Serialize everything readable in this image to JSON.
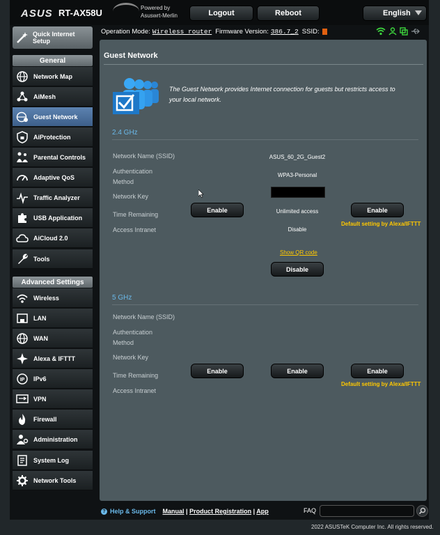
{
  "header": {
    "brand": "ASUS",
    "model": "RT-AX58U",
    "powered_by": "Powered by",
    "merlin": "Asuswrt-Merlin",
    "logout": "Logout",
    "reboot": "Reboot",
    "language": "English"
  },
  "status": {
    "op_mode_label": "Operation Mode:",
    "op_mode_value": "Wireless router",
    "fw_label": "Firmware Version:",
    "fw_value": "386.7_2",
    "ssid_label": "SSID:"
  },
  "sidebar": {
    "qis": "Quick Internet Setup",
    "general_heading": "General",
    "general_items": [
      "Network Map",
      "AiMesh",
      "Guest Network",
      "AiProtection",
      "Parental Controls",
      "Adaptive QoS",
      "Traffic Analyzer",
      "USB Application",
      "AiCloud 2.0",
      "Tools"
    ],
    "advanced_heading": "Advanced Settings",
    "advanced_items": [
      "Wireless",
      "LAN",
      "WAN",
      "Alexa & IFTTT",
      "IPv6",
      "VPN",
      "Firewall",
      "Administration",
      "System Log",
      "Network Tools"
    ]
  },
  "main": {
    "title": "Guest Network",
    "intro": "The Guest Network provides Internet connection for guests but restricts access to your local network.",
    "field_labels": {
      "ssid": "Network Name (SSID)",
      "auth": "Authentication\nMethod",
      "key": "Network Key",
      "time": "Time Remaining",
      "intranet": "Access Intranet"
    },
    "band24": {
      "heading": "2.4 GHz",
      "col1_button": "Enable",
      "col2": {
        "ssid": "ASUS_60_2G_Guest2",
        "auth": "WPA3-Personal",
        "time": "Unlimited access",
        "intranet": "Disable",
        "qr": "Show QR code",
        "button": "Disable"
      },
      "col3_button": "Enable",
      "col3_note": "Default setting by Alexa/IFTTT"
    },
    "band5": {
      "heading": "5 GHz",
      "col1_button": "Enable",
      "col2_button": "Enable",
      "col3_button": "Enable",
      "col3_note": "Default setting by Alexa/IFTTT"
    }
  },
  "footer": {
    "help": "Help & Support",
    "manual": "Manual",
    "product_registration": "Product Registration",
    "app": "App",
    "faq": "FAQ",
    "copyright": "2022 ASUSTeK Computer Inc. All rights reserved."
  },
  "colors": {
    "accent_blue": "#6ab8e8",
    "note_yellow": "#ffc800",
    "active_nav": "#4a72a0",
    "panel": "#4d5a5f"
  }
}
